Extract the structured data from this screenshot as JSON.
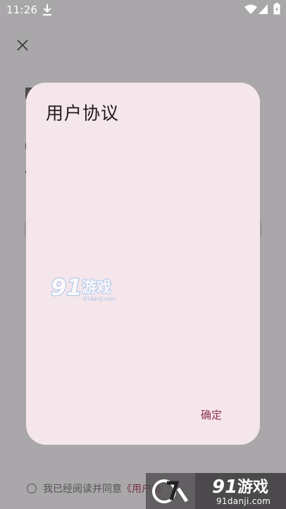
{
  "status_bar": {
    "time": "11:26",
    "icons": [
      "download-icon",
      "wifi-icon",
      "signal-icon",
      "battery-icon"
    ]
  },
  "background_screen": {
    "close_icon": "close-icon"
  },
  "dialog": {
    "title": "用户协议",
    "confirm_label": "确定",
    "body_text": "",
    "accent_color": "#8c3551",
    "background_color": "#f5e6eb"
  },
  "agreement": {
    "checked": false,
    "prefix": "我已经阅读并同意",
    "link_text": "《用户协"
  },
  "watermark": {
    "logo_text": "91游戏",
    "logo_domain": "91danji.com",
    "corner_domain": "91danji.com"
  }
}
